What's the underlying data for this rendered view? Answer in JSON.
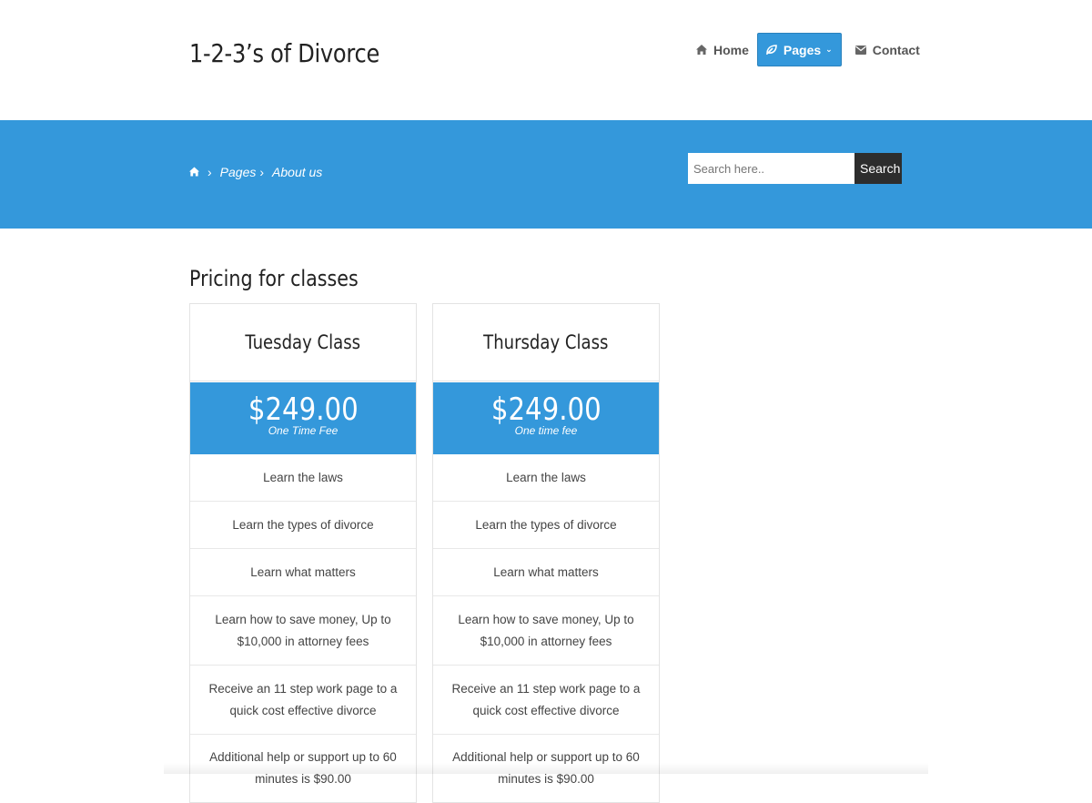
{
  "site": {
    "title": "1-2-3’s of Divorce"
  },
  "nav": {
    "items": [
      {
        "label": "Home",
        "icon": "home-icon"
      },
      {
        "label": "Pages",
        "icon": "leaf-icon",
        "active": true
      },
      {
        "label": "Contact",
        "icon": "envelope-icon"
      }
    ]
  },
  "banner": {
    "breadcrumb": {
      "icon": "home-icon",
      "pages": "Pages",
      "current": "About us"
    },
    "search": {
      "placeholder": "Search here..",
      "button": "Search"
    }
  },
  "main": {
    "title": "Pricing for classes",
    "cards": [
      {
        "name": "Tuesday Class",
        "price": "$249.00",
        "fee": "One Time Fee",
        "features": [
          "Learn the laws",
          "Learn the types of divorce",
          "Learn what matters",
          "Learn how to save money, Up to $10,000 in attorney fees",
          "Receive an 11 step work page to a quick cost effective divorce",
          "Additional help or support up to 60 minutes is $90.00"
        ]
      },
      {
        "name": "Thursday Class",
        "price": "$249.00",
        "fee": "One time fee",
        "features": [
          "Learn the laws",
          "Learn the types of divorce",
          "Learn what matters",
          "Learn how to save money, Up to $10,000 in attorney fees",
          "Receive an 11 step work page to a quick cost effective divorce",
          "Additional help or support up to 60 minutes is $90.00"
        ]
      }
    ]
  },
  "colors": {
    "accent": "#3498db",
    "dark_button": "#2d2d2d"
  }
}
